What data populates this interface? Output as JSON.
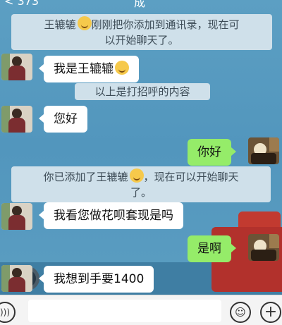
{
  "header": {
    "back_label": "< 373",
    "title": "成"
  },
  "messages": {
    "notice1_line1": "王辘辘",
    "notice1_line1b": "刚刚把你添加到通讯录，现在可",
    "notice1_line2": "以开始聊天了。",
    "m1": "我是王辘辘",
    "notice2": "以上是打招呼的内容",
    "m2": "您好",
    "m3": "你好",
    "notice3_a": "你已添加了王辘辘",
    "notice3_b": "，现在可以开始聊天",
    "notice3_line2": "了。",
    "m4": "我看您做花呗套现是吗",
    "m5": "是啊",
    "m6": "我想到手要1400"
  },
  "input_bar": {
    "placeholder": ""
  },
  "icons": [
    "voice-icon",
    "emoji-icon",
    "plus-icon",
    "smile-emoji-icon"
  ],
  "colors": {
    "bubble_self": "#95ec69",
    "bubble_other": "#ffffff",
    "notice_bg": "#cfe0ea"
  }
}
